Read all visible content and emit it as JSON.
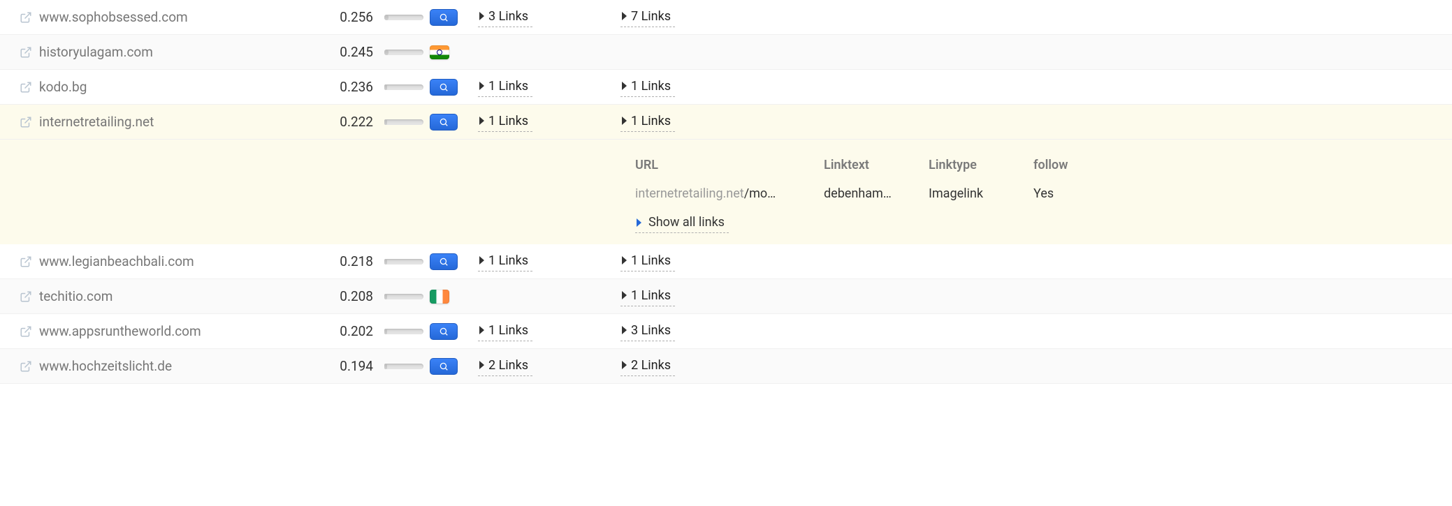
{
  "flags": {
    "india": "flag-india",
    "ireland": "flag-ireland"
  },
  "rows": [
    {
      "domain": "www.sophobsessed.com",
      "score": "0.256",
      "bar": 10,
      "badge": "search",
      "links1": "3 Links",
      "links2": "7 Links",
      "alt": false
    },
    {
      "domain": "historyulagam.com",
      "score": "0.245",
      "bar": 10,
      "badge": "flag-india",
      "links1": "",
      "links2": "",
      "alt": true
    },
    {
      "domain": "kodo.bg",
      "score": "0.236",
      "bar": 8,
      "badge": "search",
      "links1": "1 Links",
      "links2": "1 Links",
      "alt": false
    },
    {
      "domain": "internetretailing.net",
      "score": "0.222",
      "bar": 8,
      "badge": "search",
      "links1": "1 Links",
      "links2": "1 Links",
      "alt": false,
      "expanded": true
    },
    {
      "domain": "www.legianbeachbali.com",
      "score": "0.218",
      "bar": 8,
      "badge": "search",
      "links1": "1 Links",
      "links2": "1 Links",
      "alt": false
    },
    {
      "domain": "techitio.com",
      "score": "0.208",
      "bar": 8,
      "badge": "flag-ireland",
      "links1": "",
      "links2": "1 Links",
      "alt": true
    },
    {
      "domain": "www.appsruntheworld.com",
      "score": "0.202",
      "bar": 8,
      "badge": "search",
      "links1": "1 Links",
      "links2": "3 Links",
      "alt": false
    },
    {
      "domain": "www.hochzeitslicht.de",
      "score": "0.194",
      "bar": 7,
      "badge": "search",
      "links1": "2 Links",
      "links2": "2 Links",
      "alt": true
    }
  ],
  "detail": {
    "headers": {
      "url": "URL",
      "linktext": "Linktext",
      "linktype": "Linktype",
      "follow": "follow"
    },
    "row": {
      "url_prefix": "internetretailing.net",
      "url_path": "/mo…",
      "linktext": "debenham…",
      "linktype": "Imagelink",
      "follow": "Yes"
    },
    "show_all": "Show all links"
  }
}
